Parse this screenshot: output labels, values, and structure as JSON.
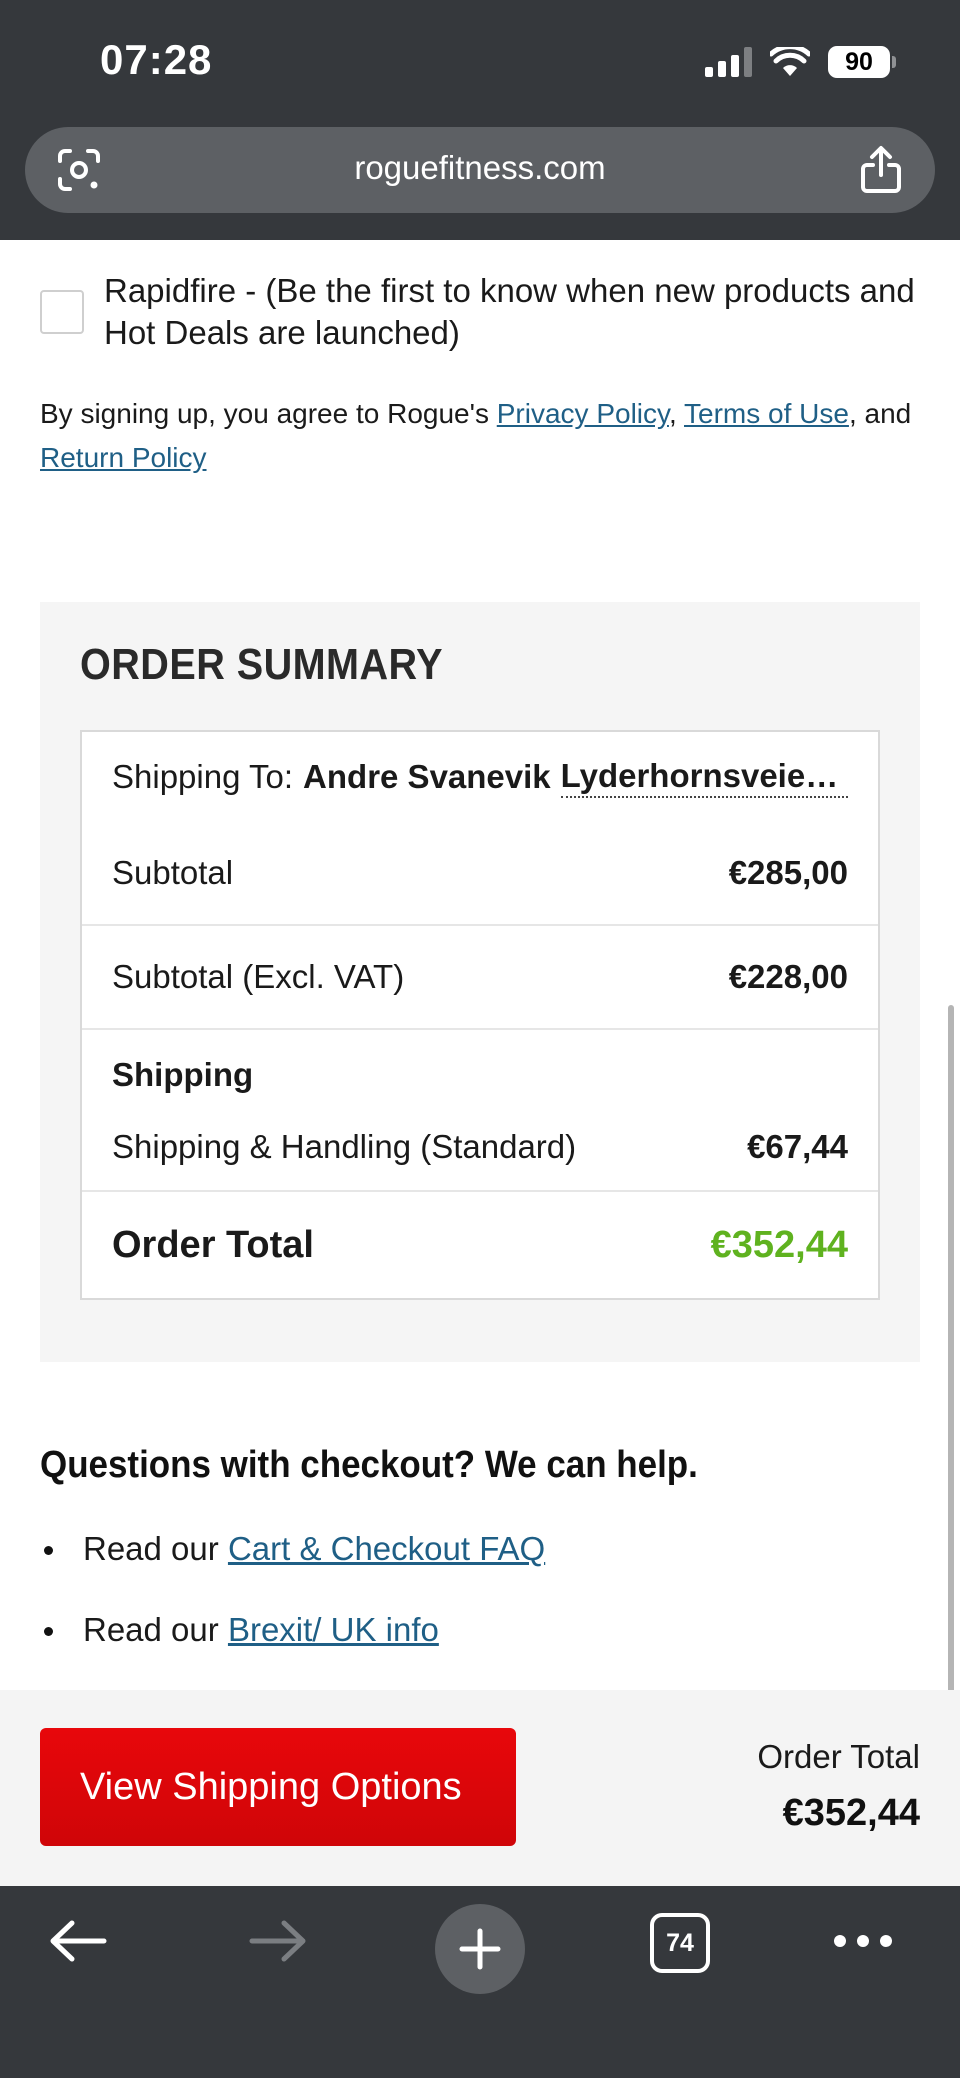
{
  "status_bar": {
    "time": "07:28",
    "battery": "90"
  },
  "browser": {
    "url": "roguefitness.com",
    "tab_count": "74"
  },
  "newsletter": {
    "rapidfire_label": "Rapidfire - (Be the first to know when new products and Hot Deals are launched)",
    "agree_prefix": "By signing up, you agree to Rogue's ",
    "privacy_link": "Privacy Policy",
    "comma": ", ",
    "terms_link": "Terms of Use",
    "and_text": ", and ",
    "return_link": "Return Policy"
  },
  "order_summary": {
    "title": "ORDER SUMMARY",
    "shipping_to_label": "Shipping To:",
    "shipping_to_name": "Andre Svanevik",
    "shipping_to_address": "Lyderhornsveien …",
    "subtotal_label": "Subtotal",
    "subtotal_value": "€285,00",
    "subtotal_excl_label": "Subtotal (Excl. VAT)",
    "subtotal_excl_value": "€228,00",
    "shipping_heading": "Shipping",
    "shipping_method_label": "Shipping & Handling (Standard)",
    "shipping_method_value": "€67,44",
    "total_label": "Order Total",
    "total_value": "€352,44"
  },
  "help": {
    "title": "Questions with checkout? We can help.",
    "items": [
      {
        "prefix": "Read our ",
        "link": "Cart & Checkout FAQ"
      },
      {
        "prefix": "Read our ",
        "link": "Brexit/ UK info"
      }
    ]
  },
  "footer": {
    "cta_label": "View Shipping Options",
    "total_label": "Order Total",
    "total_value": "€352,44"
  },
  "colors": {
    "chrome_bg": "#35383c",
    "cta_red": "#e0060a",
    "total_green": "#5fb21f",
    "link_blue": "#1f5f86"
  },
  "icons": [
    "google-lens-icon",
    "share-icon",
    "back-arrow-icon",
    "forward-arrow-icon",
    "plus-icon",
    "tabs-icon",
    "more-dots-icon",
    "wifi-icon",
    "signal-icon",
    "battery-icon"
  ]
}
